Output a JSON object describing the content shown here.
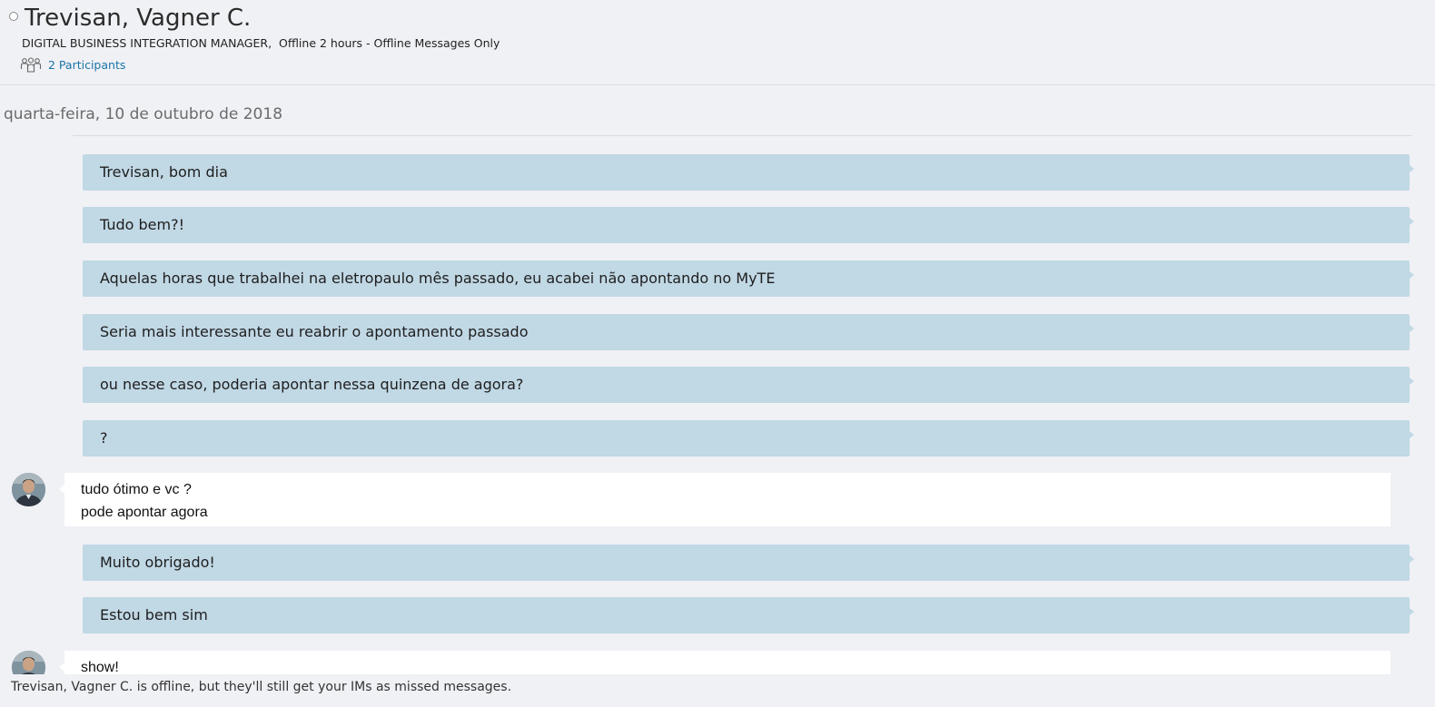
{
  "conversation": {
    "contact_name": "Trevisan, Vagner C.",
    "job_title": "DIGITAL BUSINESS INTEGRATION MANAGER",
    "presence": "Offline 2 hours - Offline Messages Only",
    "participants_label": "2 Participants",
    "presence_color": "#ffffff",
    "link_color": "#1a74a8"
  },
  "date_separator": "quarta-feira, 10 de outubro de 2018",
  "messages": {
    "m1": "Trevisan, bom dia",
    "m2": "Tudo bem?!",
    "m3": "Aquelas horas que trabalhei na eletropaulo mês passado, eu acabei não apontando no MyTE",
    "m4": "Seria mais interessante eu reabrir o apontamento passado",
    "m5": "ou nesse caso, poderia apontar nessa quinzena de agora?",
    "m6": "?",
    "r1_line1": "tudo ótimo e vc ?",
    "r1_line2": "pode apontar agora",
    "m7": "Muito obrigado!",
    "m8": "Estou bem sim",
    "r2_line1": "show!"
  },
  "colors": {
    "outgoing_bubble": "#c1d8e5",
    "incoming_bubble": "#ffffff",
    "background": "#f0f1f5"
  },
  "footer": {
    "notice": "Trevisan, Vagner C. is offline, but they'll still get your IMs as missed messages."
  }
}
